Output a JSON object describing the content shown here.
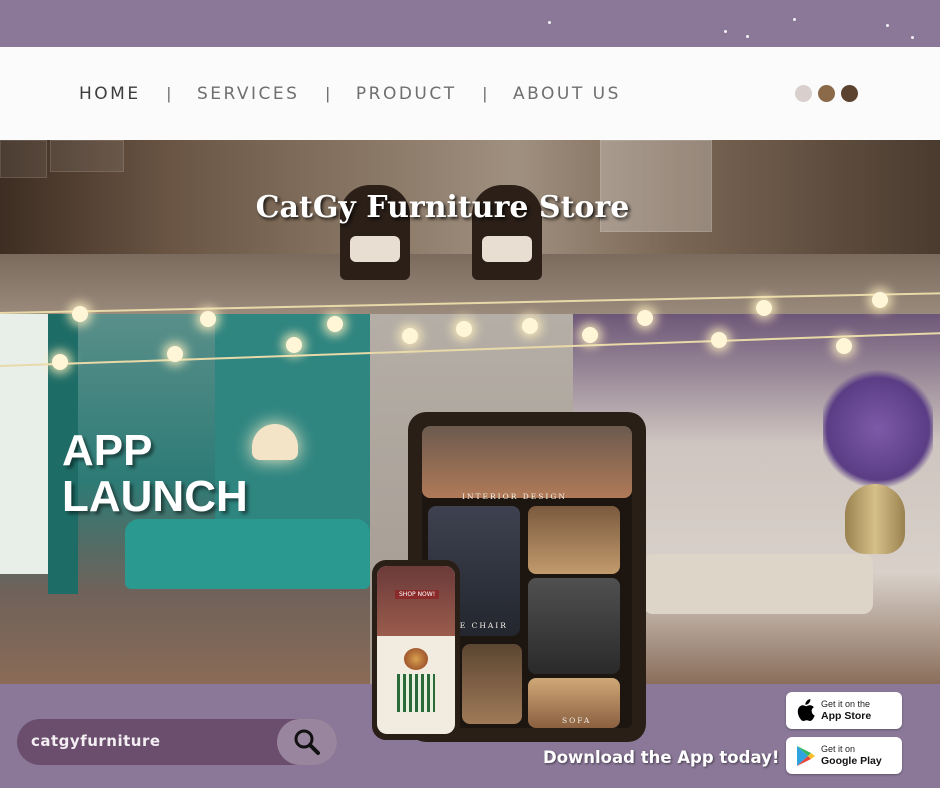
{
  "nav": {
    "items": [
      "HOME",
      "SERVICES",
      "PRODUCT",
      "ABOUT US"
    ],
    "separator": "|"
  },
  "theme": {
    "dots": [
      "#d9d0ce",
      "#8b6a4a",
      "#5c4330"
    ],
    "accent": "#8b7898",
    "search_bg": "#6b4e6d"
  },
  "hero": {
    "title": "CatGy Furniture Store"
  },
  "promo": {
    "headline_line1": "APP",
    "headline_line2": "LAUNCH",
    "download_text": "Download the App today!"
  },
  "search": {
    "value": "catgyfurniture",
    "icon": "search-icon"
  },
  "tablet": {
    "labels": [
      "INTERIOR DESIGN",
      "CE CHAIR",
      "SOFA"
    ]
  },
  "phone": {
    "button": "SHOP NOW!"
  },
  "stores": [
    {
      "small": "Get it on the",
      "big": "App Store",
      "icon": "apple-icon"
    },
    {
      "small": "Get it on",
      "big": "Google Play",
      "icon": "google-play-icon"
    }
  ]
}
